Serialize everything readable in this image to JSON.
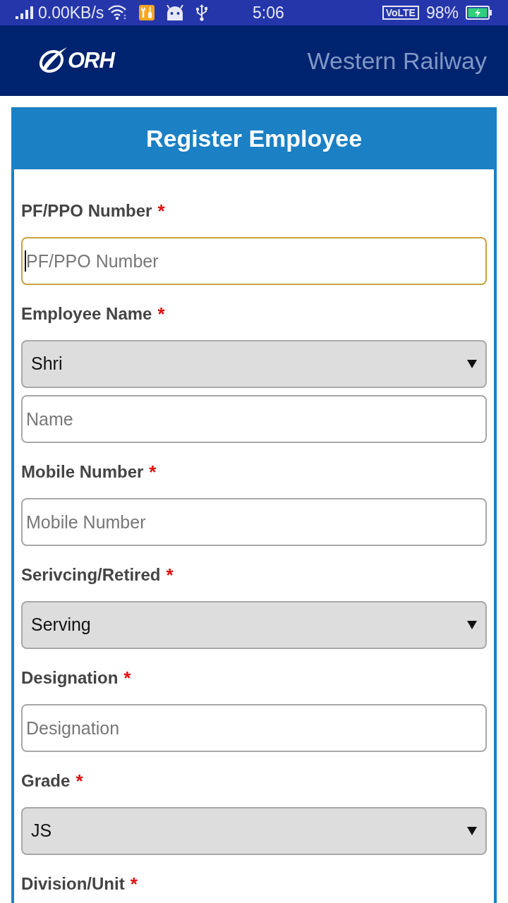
{
  "status_bar": {
    "network_speed": "0.00KB/s",
    "time": "5:06",
    "network_badge": "VoLTE",
    "battery": "98%"
  },
  "header": {
    "logo_text": "ORH",
    "title": "Western Railway"
  },
  "form": {
    "title": "Register Employee",
    "required_mark": "*",
    "groups": [
      {
        "label": "PF/PPO Number",
        "required": true,
        "controls": [
          {
            "kind": "input",
            "placeholder": "PF/PPO Number",
            "focused": true
          }
        ]
      },
      {
        "label": "Employee Name",
        "required": true,
        "controls": [
          {
            "kind": "select",
            "value": "Shri"
          },
          {
            "kind": "input",
            "placeholder": "Name",
            "focused": false
          }
        ]
      },
      {
        "label": "Mobile Number",
        "required": true,
        "controls": [
          {
            "kind": "input",
            "placeholder": "Mobile Number",
            "focused": false
          }
        ]
      },
      {
        "label": "Serivcing/Retired",
        "required": true,
        "controls": [
          {
            "kind": "select",
            "value": "Serving"
          }
        ]
      },
      {
        "label": "Designation",
        "required": true,
        "controls": [
          {
            "kind": "input",
            "placeholder": "Designation",
            "focused": false
          }
        ]
      },
      {
        "label": "Grade",
        "required": true,
        "controls": [
          {
            "kind": "select",
            "value": "JS"
          }
        ]
      },
      {
        "label": "Division/Unit",
        "required": true
      }
    ]
  }
}
